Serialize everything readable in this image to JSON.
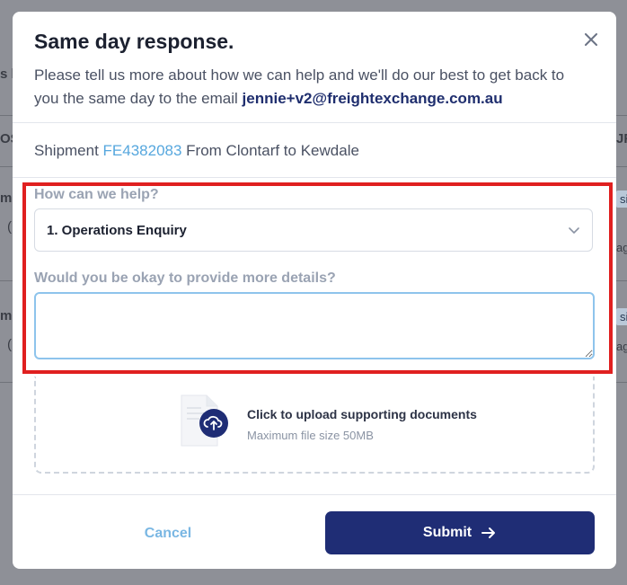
{
  "background": {
    "fragments": [
      "s l",
      "OS",
      "m",
      "(",
      "m",
      "(",
      "JR",
      "sit",
      "ag",
      "sit",
      "ag"
    ]
  },
  "modal": {
    "title": "Same day response.",
    "close_icon": "close-icon",
    "subtitle": "Please tell us more about how we can help and we'll do our best to get back to you the same day to the email ",
    "email": "jennie+v2@freightexchange.com.au"
  },
  "shipment": {
    "prefix": "Shipment ",
    "id": "FE4382083",
    "route": " From Clontarf to Kewdale"
  },
  "form": {
    "help_label": "How can we help?",
    "help_value": "1. Operations Enquiry",
    "details_label": "Would you be okay to provide more details?",
    "details_value": ""
  },
  "upload": {
    "main": "Click to upload supporting documents",
    "sub": "Maximum file size 50MB",
    "icon": "upload-cloud-icon"
  },
  "actions": {
    "cancel": "Cancel",
    "submit": "Submit"
  },
  "colors": {
    "primary": "#1f2d75",
    "link": "#56a7de",
    "highlight": "#e02020"
  }
}
